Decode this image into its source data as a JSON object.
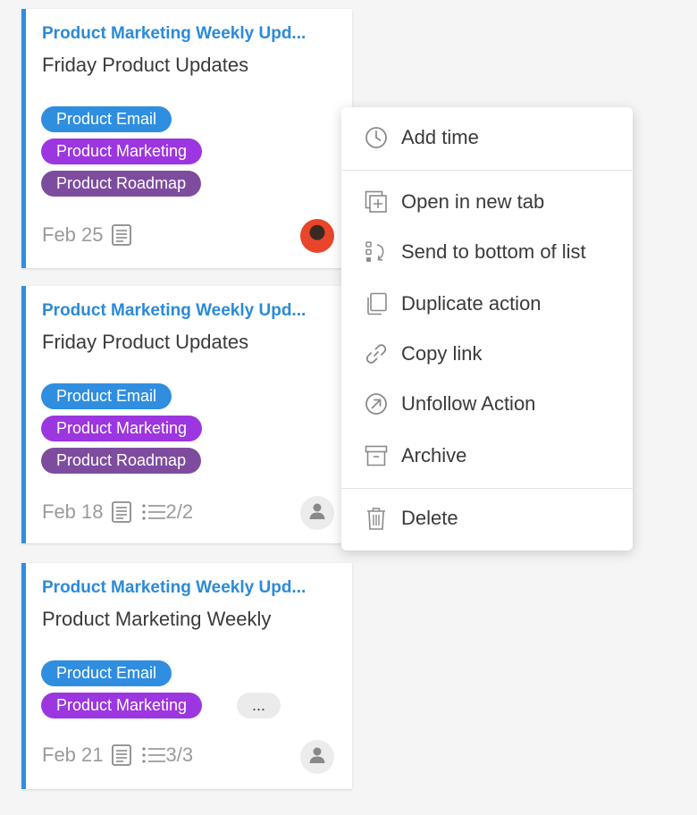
{
  "cards": [
    {
      "heading": "Product Marketing Weekly Upd...",
      "title": "Friday Product Updates",
      "tags": [
        "Product Email",
        "Product Marketing",
        "Product Roadmap"
      ],
      "date": "Feb 25",
      "checklist": "",
      "avatar": "photo"
    },
    {
      "heading": "Product Marketing Weekly Upd...",
      "title": "Friday Product Updates",
      "tags": [
        "Product Email",
        "Product Marketing",
        "Product Roadmap"
      ],
      "date": "Feb 18",
      "checklist": "2/2",
      "avatar": "default"
    },
    {
      "heading": "Product Marketing Weekly Upd...",
      "title": "Product Marketing Weekly",
      "tags": [
        "Product Email",
        "Product Marketing"
      ],
      "more_tags": "...",
      "date": "Feb 21",
      "checklist": "3/3",
      "avatar": "default"
    }
  ],
  "context_menu": {
    "items": [
      {
        "label": "Add time",
        "icon": "clock-icon"
      },
      {
        "label": "Open in new tab",
        "icon": "new-tab-icon"
      },
      {
        "label": "Send to bottom of list",
        "icon": "send-to-bottom-icon"
      },
      {
        "label": "Duplicate action",
        "icon": "duplicate-icon"
      },
      {
        "label": "Copy link",
        "icon": "link-icon"
      },
      {
        "label": "Unfollow Action",
        "icon": "unfollow-icon"
      },
      {
        "label": "Archive",
        "icon": "archive-icon"
      },
      {
        "label": "Delete",
        "icon": "trash-icon"
      }
    ]
  },
  "colors": {
    "accent": "#2f8ee0",
    "tag_email": "#2f8ee0",
    "tag_marketing": "#9c36e0",
    "tag_roadmap": "#7e4c9e"
  }
}
